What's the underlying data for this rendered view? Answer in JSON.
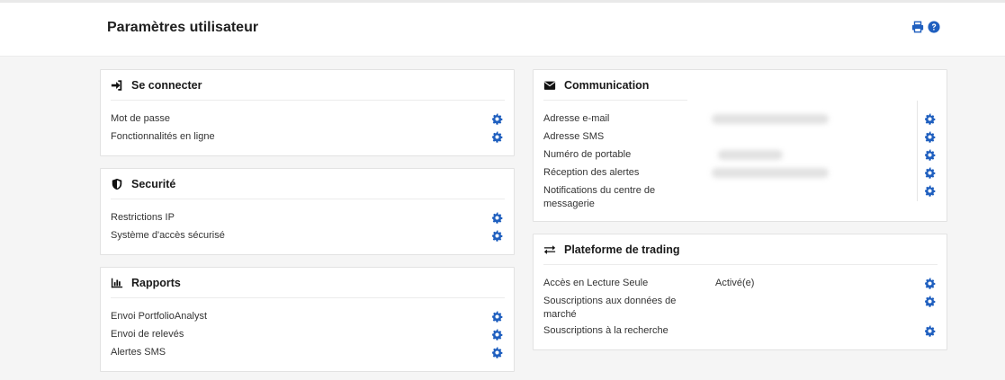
{
  "header": {
    "title": "Paramètres utilisateur",
    "icons": [
      "print-icon",
      "help-icon"
    ]
  },
  "colors": {
    "accent": "#1f5fbf",
    "panel_border": "#e2e2e2",
    "background": "#f5f5f5"
  },
  "panels": {
    "connect": {
      "title": "Se connecter",
      "icon": "sign-in-icon",
      "items": [
        {
          "label": "Mot de passe"
        },
        {
          "label": "Fonctionnalités en ligne"
        }
      ]
    },
    "security": {
      "title": "Securité",
      "icon": "shield-icon",
      "items": [
        {
          "label": "Restrictions IP"
        },
        {
          "label": "Système d'accès sécurisé"
        }
      ]
    },
    "reports": {
      "title": "Rapports",
      "icon": "bar-chart-icon",
      "items": [
        {
          "label": "Envoi PortfolioAnalyst"
        },
        {
          "label": "Envoi de relevés"
        },
        {
          "label": "Alertes SMS"
        }
      ]
    },
    "communication": {
      "title": "Communication",
      "icon": "envelope-icon",
      "items": [
        {
          "label": "Adresse e-mail",
          "value_redacted": true
        },
        {
          "label": "Adresse SMS"
        },
        {
          "label": "Numéro de portable",
          "value_redacted": true
        },
        {
          "label": "Réception des alertes",
          "value_redacted": true
        },
        {
          "label_line1": "Notifications du centre de",
          "label_line2": "messagerie"
        }
      ]
    },
    "trading": {
      "title": "Plateforme de trading",
      "icon": "exchange-icon",
      "items": [
        {
          "label": "Accès en Lecture Seule",
          "value": "Activé(e)"
        },
        {
          "label_line1": "Souscriptions aux données de",
          "label_line2": "marché"
        },
        {
          "label": "Souscriptions à la recherche"
        }
      ]
    }
  }
}
